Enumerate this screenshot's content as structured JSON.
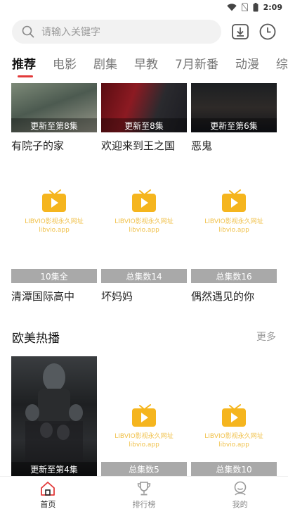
{
  "status_bar": {
    "time": "2:09"
  },
  "search": {
    "placeholder": "请输入关键字"
  },
  "tabs": [
    {
      "label": "推荐"
    },
    {
      "label": "电影"
    },
    {
      "label": "剧集"
    },
    {
      "label": "早教"
    },
    {
      "label": "7月新番"
    },
    {
      "label": "动漫"
    },
    {
      "label": "综"
    }
  ],
  "row1": [
    {
      "title": "有院子的家",
      "badge": "更新至第8集"
    },
    {
      "title": "欢迎来到王之国",
      "badge": "更新至8集"
    },
    {
      "title": "恶鬼",
      "badge": "更新至第6集"
    }
  ],
  "row2": [
    {
      "title": "清潭国际高中",
      "badge": "10集全"
    },
    {
      "title": "坏妈妈",
      "badge": "总集数14"
    },
    {
      "title": "偶然遇见的你",
      "badge": "总集数16"
    }
  ],
  "placeholder_text": {
    "line1": "LIBVIO影视永久网址",
    "line2": "libvio.app"
  },
  "section2": {
    "title": "欧美热播",
    "more": "更多"
  },
  "row3": [
    {
      "badge": "更新至第4集"
    },
    {
      "badge": "总集数5"
    },
    {
      "badge": "总集数10"
    }
  ],
  "bottom_nav": [
    {
      "label": "首页"
    },
    {
      "label": "排行榜"
    },
    {
      "label": "我的"
    }
  ],
  "colors": {
    "accent": "#e23a3a",
    "placeholder_yellow": "#f5b51e"
  }
}
